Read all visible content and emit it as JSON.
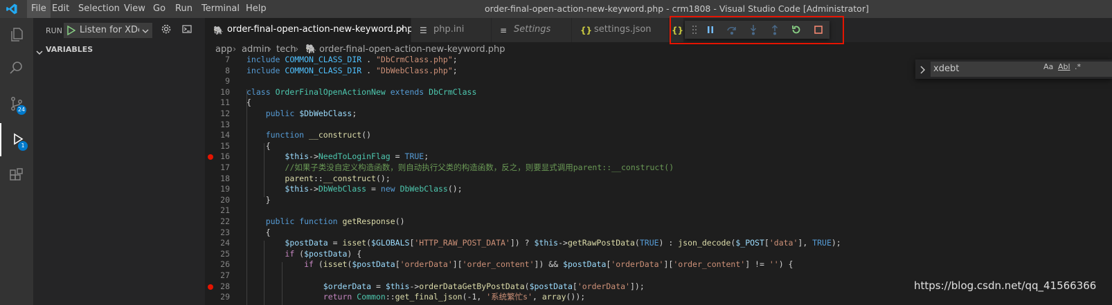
{
  "titlebar": {
    "menus": [
      "File",
      "Edit",
      "Selection",
      "View",
      "Go",
      "Run",
      "Terminal",
      "Help"
    ],
    "window_title": "order-final-open-action-new-keyword.php - crm1808 - Visual Studio Code [Administrator]"
  },
  "activity_bar": {
    "source_control_badge": "24",
    "debug_badge": "1"
  },
  "sidebar": {
    "run_label": "RUN",
    "config_selected": "Listen for XDebug",
    "variables_header": "VARIABLES"
  },
  "tabs": [
    {
      "label": "order-final-open-action-new-keyword.php",
      "icon": "php-elephant-icon",
      "close": "×"
    },
    {
      "label": "php.ini",
      "icon": "file-icon"
    },
    {
      "label": "Settings",
      "icon": "list-icon"
    },
    {
      "label": "settings.json",
      "icon": "json-braces-icon"
    }
  ],
  "breadcrumbs": [
    "app",
    "admin",
    "tech",
    "order-final-open-action-new-keyword.php"
  ],
  "find": {
    "query": "xdebt",
    "opt_case": "Aa",
    "opt_word": "Abl",
    "opt_regex": ".*"
  },
  "code_lines": [
    {
      "n": "7",
      "text": "include COMMON_CLASS_DIR . \"DbCrmClass.php\";"
    },
    {
      "n": "8",
      "text": "include COMMON_CLASS_DIR . \"DbWebClass.php\";"
    },
    {
      "n": "9",
      "text": ""
    },
    {
      "n": "10",
      "text": "class OrderFinalOpenActionNew extends DbCrmClass"
    },
    {
      "n": "11",
      "text": "{"
    },
    {
      "n": "12",
      "text": "    public $DbWebClass;"
    },
    {
      "n": "13",
      "text": ""
    },
    {
      "n": "14",
      "text": "    function __construct()"
    },
    {
      "n": "15",
      "text": "    {"
    },
    {
      "n": "16",
      "text": "        $this->NeedToLoginFlag = TRUE;"
    },
    {
      "n": "17",
      "text": "        //如果子类没自定义构造函数，则自动执行父类的构造函数，反之，则要显式调用parent::__construct()"
    },
    {
      "n": "18",
      "text": "        parent::__construct();"
    },
    {
      "n": "19",
      "text": "        $this->DbWebClass = new DbWebClass();"
    },
    {
      "n": "20",
      "text": "    }"
    },
    {
      "n": "21",
      "text": ""
    },
    {
      "n": "22",
      "text": "    public function getResponse()"
    },
    {
      "n": "23",
      "text": "    {"
    },
    {
      "n": "24",
      "text": "        $postData = isset($GLOBALS['HTTP_RAW_POST_DATA']) ? $this->getRawPostData(TRUE) : json_decode($_POST['data'], TRUE);"
    },
    {
      "n": "25",
      "text": "        if ($postData) {"
    },
    {
      "n": "26",
      "text": "            if (isset($postData['orderData']['order_content']) && $postData['orderData']['order_content'] != '') {"
    },
    {
      "n": "27",
      "text": ""
    },
    {
      "n": "28",
      "text": "                $orderData = $this->orderDataGetByPostData($postData['orderData']);"
    },
    {
      "n": "29",
      "text": "                return Common::get_final_json(-1, '系统繁忙s', array());"
    }
  ],
  "breakpoint_lines": [
    "16",
    "28"
  ],
  "watermark": "https://blog.csdn.net/qq_41566366",
  "colors": {
    "accent": "#007acc",
    "breakpoint": "#e51400",
    "highlight_box": "#e51400"
  }
}
